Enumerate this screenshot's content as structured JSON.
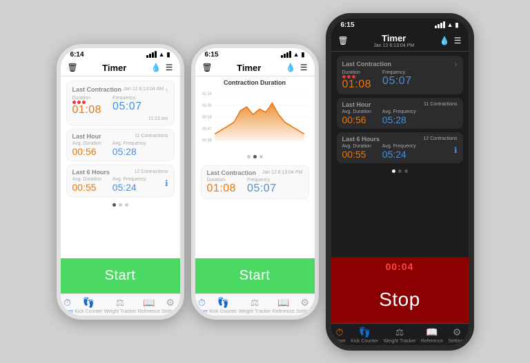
{
  "phone1": {
    "status": {
      "time": "6:14",
      "signal": true,
      "wifi": true,
      "battery": true
    },
    "title": "Timer",
    "last_contraction": {
      "label": "Last Contraction",
      "duration_label": "Duration",
      "frequency_label": "Frequency",
      "duration": "01:08",
      "frequency": "05:07",
      "timestamp": "Jan 12 6:13:04 AM",
      "time_ago": "11:13 am"
    },
    "last_hour": {
      "label": "Last Hour",
      "avg_duration_label": "Avg. Duration",
      "avg_frequency_label": "Avg. Frequency",
      "avg_duration": "00:56",
      "avg_frequency": "05:28",
      "contractions": "11 Contractions"
    },
    "last_6hours": {
      "label": "Last 6 Hours",
      "avg_duration_label": "Avg. Duration",
      "avg_frequency_label": "Avg. Frequency",
      "avg_duration": "00:55",
      "avg_frequency": "05:24",
      "contractions": "12 Contractions"
    },
    "start_button": "Start",
    "tabs": [
      "Timer",
      "Kick Counter",
      "Weight Tracker",
      "Reference",
      "Settings"
    ]
  },
  "phone2": {
    "status": {
      "time": "6:15"
    },
    "title": "Timer",
    "chart_title": "Contraction Duration",
    "last_contraction": {
      "label": "Last Contraction",
      "duration_label": "Duration",
      "frequency_label": "Frequency",
      "duration": "01:08",
      "frequency": "05:07",
      "timestamp": "Jan 12 6:13:04 PM"
    },
    "start_button": "Start",
    "tabs": [
      "Timer",
      "Kick Counter",
      "Weight Tracker",
      "Reference",
      "Settings"
    ]
  },
  "phone3": {
    "status": {
      "time": "6:15",
      "timestamp": "Jan 12 6:13:04 PM"
    },
    "title": "Timer",
    "last_contraction": {
      "label": "Last Contraction",
      "duration_label": "Duration",
      "frequency_label": "Frequency",
      "duration": "01:08",
      "frequency": "05:07"
    },
    "last_hour": {
      "label": "Last Hour",
      "avg_duration_label": "Avg. Duration",
      "avg_frequency_label": "Avg. Frequency",
      "avg_duration": "00:56",
      "avg_frequency": "05:28",
      "contractions": "11 Contractions"
    },
    "last_6hours": {
      "label": "Last 6 Hours",
      "avg_duration_label": "Avg. Duration",
      "avg_frequency_label": "Avg. Frequency",
      "avg_duration": "00:55",
      "avg_frequency": "05:24",
      "contractions": "12 Contractions"
    },
    "timer_display": "00:04",
    "stop_button": "Stop",
    "tabs": [
      "Timer",
      "Kick Counter",
      "Weight Tracker",
      "Reference",
      "Settings"
    ]
  }
}
